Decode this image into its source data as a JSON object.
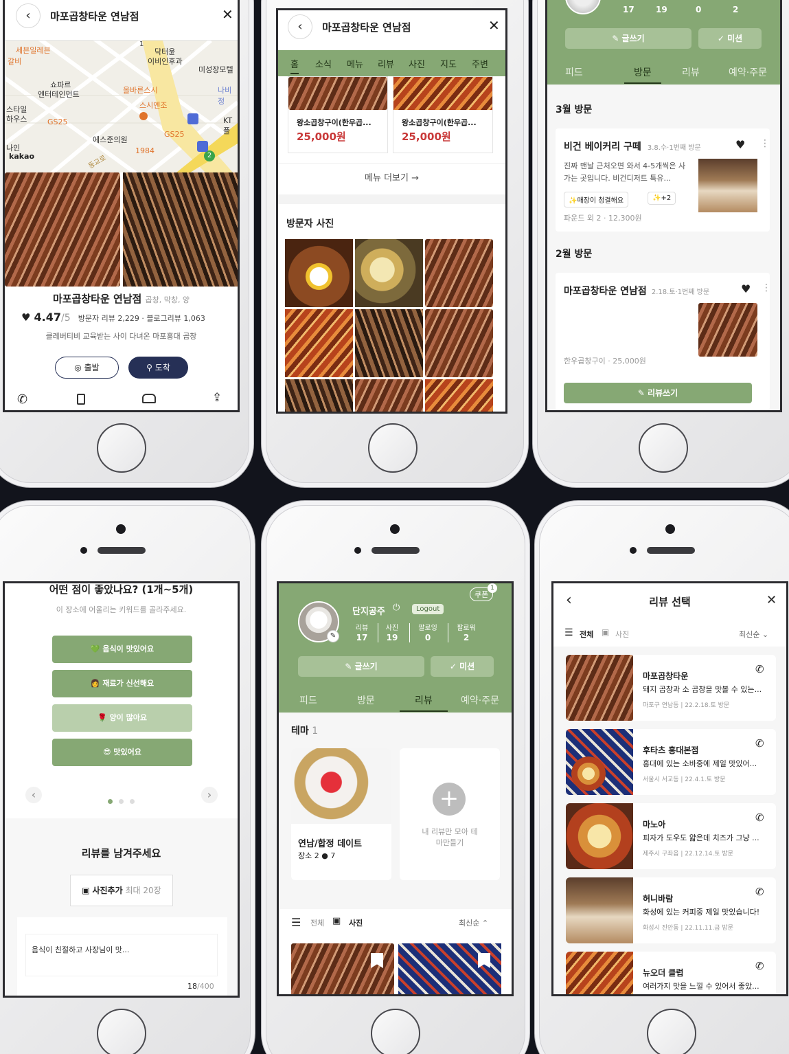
{
  "screen1": {
    "title": "마포곱창타운 연남점",
    "map_labels": [
      "세븐일레븐",
      "갈비",
      "닥터윤",
      "이비인후과",
      "미성장모텔",
      "쇼파르",
      "엔터테인먼트",
      "올바른스시",
      "나비정",
      "스시엔조",
      "스타일",
      "하우스",
      "GS25",
      "KT플",
      "에스준의원",
      "GS25",
      "1984",
      "나인",
      "kakao",
      "동교로"
    ],
    "map_badge": "1",
    "map_route": "2",
    "place_name": "마포곱창타운 연남점",
    "place_category": "곱창, 막창, 양",
    "rating": "4.47",
    "rating_max": "/5",
    "reviews": "방문자 리뷰 2,229 · 블로그리뷰 1,063",
    "tagline": "클레버티비 교육받는 사이 다녀온 마포홍대 곱창",
    "depart_label": "출발",
    "arrive_label": "도착"
  },
  "screen2": {
    "title": "마포곱창타운 연남점",
    "tabs": [
      "홈",
      "소식",
      "메뉴",
      "리뷰",
      "사진",
      "지도",
      "주변"
    ],
    "menu_items": [
      {
        "name": "왕소곱창구이(한우곱...",
        "price": "25,000원"
      },
      {
        "name": "왕소곱창구이(한우곱...",
        "price": "25,000원"
      }
    ],
    "more_label": "메뉴 더보기 →",
    "visitor_photos_title": "방문자 사진"
  },
  "screen3": {
    "counts": [
      "17",
      "19",
      "0",
      "2"
    ],
    "write_label": "글쓰기",
    "mission_label": "미션",
    "tabs": [
      "피드",
      "방문",
      "리뷰",
      "예약·주문"
    ],
    "month1": "3월 방문",
    "card1": {
      "name": "비건 베이커리 구떼",
      "meta": "3.8.수·1번째 방문",
      "text": "진짜 맨날 근처오면 와서 4-5개씩은 사가는 곳입니다. 비건디저트 특유...",
      "tag1": "매장이 청결해요",
      "tag2": "+2",
      "footer": "파운드 외 2 · 12,300원"
    },
    "month2": "2월 방문",
    "card2": {
      "name": "마포곱창타운 연남점",
      "meta": "2.18.토·1번째 방문",
      "footer": "한우곱창구이 · 25,000원"
    },
    "review_btn": "리뷰쓰기"
  },
  "screen4": {
    "question": "어떤 점이 좋았나요? (1개~5개)",
    "hint": "이 장소에 어울리는 키워드를 골라주세요.",
    "keywords": [
      {
        "icon": "💚",
        "label": "음식이 맛있어요"
      },
      {
        "icon": "👩‍🍳",
        "label": "재료가 신선해요"
      },
      {
        "icon": "🌹",
        "label": "양이 많아요"
      },
      {
        "icon": "😎",
        "label": "맛있어요"
      }
    ],
    "leave_review": "리뷰를 남겨주세요",
    "add_photo": "사진추가",
    "add_photo_max": "최대 20장",
    "review_text": "음식이 친절하고 사장님이 맛...",
    "char_count": "18",
    "char_max": "/400"
  },
  "screen5": {
    "coupon": "쿠폰",
    "coupon_count": "1",
    "username": "단지공주",
    "logout": "Logout",
    "stats": [
      {
        "label": "리뷰",
        "value": "17"
      },
      {
        "label": "사진",
        "value": "19"
      },
      {
        "label": "팔로잉",
        "value": "0"
      },
      {
        "label": "팔로워",
        "value": "2"
      }
    ],
    "write_label": "글쓰기",
    "mission_label": "미션",
    "tabs": [
      "피드",
      "방문",
      "리뷰",
      "예약·주문"
    ],
    "theme_title": "테마",
    "theme_count": "1",
    "theme_card": {
      "title": "연남/합정 데이트",
      "meta": "장소 2",
      "views": "7"
    },
    "make_theme": "내 리뷰만 모아 테마만들기",
    "filter_all": "전체",
    "filter_photo": "사진",
    "sort": "최신순"
  },
  "screen6": {
    "title": "리뷰 선택",
    "filter_all": "전체",
    "filter_photo": "사진",
    "sort": "최신순",
    "items": [
      {
        "name": "마포곱창타운",
        "text": "돼지 곱창과 소 곱창을 맛볼 수 있는...",
        "meta": "마포구 연남동 | 22.2.18.토 방문"
      },
      {
        "name": "후타츠 홍대본점",
        "text": "홍대에 있는 소바중에 제일 맛있어...",
        "meta": "서울시 서교동 | 22.4.1.토 방문"
      },
      {
        "name": "마노아",
        "text": "피자가 도우도 얇은데 치즈가 그냥 ...",
        "meta": "제주시 구좌읍 | 22.12.14.토 방문"
      },
      {
        "name": "허니바람",
        "text": "화성에 있는 커피중 제일 맛있습니다!",
        "meta": "화성시 진안동 | 22.11.11.금 방문"
      },
      {
        "name": "뉴오더 클럽",
        "text": "여러가지 맛을 느낄 수 있어서 좋았...",
        "meta": ""
      }
    ]
  }
}
